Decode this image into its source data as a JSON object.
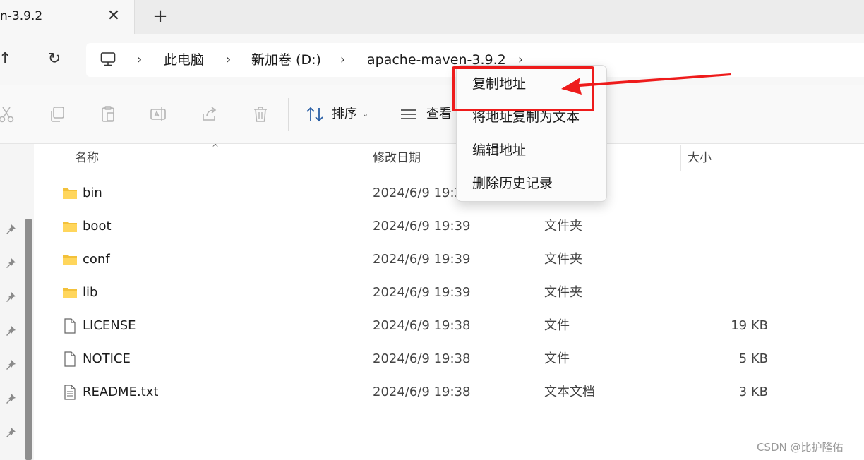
{
  "tab": {
    "title": "n-3.9.2",
    "close_glyph": "✕",
    "new_glyph": "+"
  },
  "nav": {
    "up_glyph": "↑",
    "refresh_glyph": "↻"
  },
  "address": {
    "icon": "computer-icon",
    "separator": "›",
    "crumbs": [
      "此电脑",
      "新加卷 (D:)",
      "apache-maven-3.9.2"
    ]
  },
  "toolbar": {
    "icons": [
      "cut-icon",
      "copy-icon",
      "paste-icon",
      "rename-icon",
      "share-icon",
      "delete-icon"
    ],
    "sort_label": "排序",
    "view_label": "查看"
  },
  "columns": {
    "name": "名称",
    "modified": "修改日期",
    "size": "大小"
  },
  "files": [
    {
      "name": "bin",
      "date": "2024/6/9 19:39",
      "type": "",
      "size": "",
      "icon": "folder-icon"
    },
    {
      "name": "boot",
      "date": "2024/6/9 19:39",
      "type": "文件夹",
      "size": "",
      "icon": "folder-icon"
    },
    {
      "name": "conf",
      "date": "2024/6/9 19:39",
      "type": "文件夹",
      "size": "",
      "icon": "folder-icon"
    },
    {
      "name": "lib",
      "date": "2024/6/9 19:39",
      "type": "文件夹",
      "size": "",
      "icon": "folder-icon"
    },
    {
      "name": "LICENSE",
      "date": "2024/6/9 19:38",
      "type": "文件",
      "size": "19 KB",
      "icon": "file-icon"
    },
    {
      "name": "NOTICE",
      "date": "2024/6/9 19:38",
      "type": "文件",
      "size": "5 KB",
      "icon": "file-icon"
    },
    {
      "name": "README.txt",
      "date": "2024/6/9 19:38",
      "type": "文本文档",
      "size": "3 KB",
      "icon": "text-file-icon"
    }
  ],
  "context_menu": {
    "items": [
      "复制地址",
      "将地址复制为文本",
      "编辑地址",
      "删除历史记录"
    ]
  },
  "annotation": {
    "color": "#ee1b1b"
  },
  "watermark": "CSDN @比护隆佑"
}
